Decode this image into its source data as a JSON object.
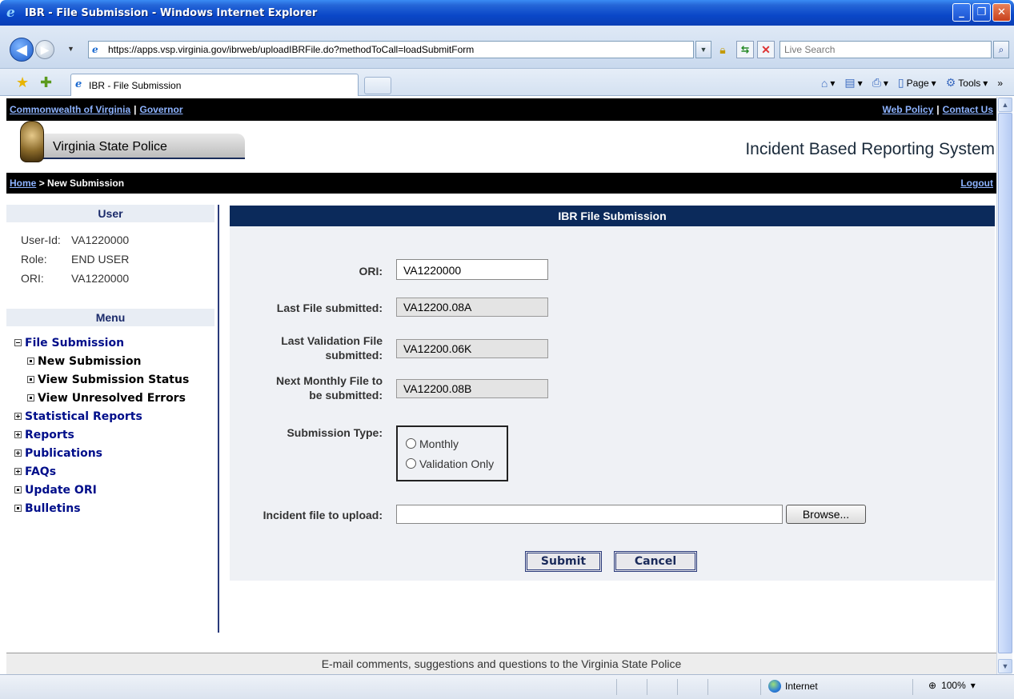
{
  "window": {
    "title": "IBR - File Submission - Windows Internet Explorer",
    "minimize": "_",
    "maximize": "❐",
    "close": "✕"
  },
  "browser": {
    "url": "https://apps.vsp.virginia.gov/ibrweb/uploadIBRFile.do?methodToCall=loadSubmitForm",
    "search_placeholder": "Live Search",
    "tab_title": "IBR - File Submission",
    "cmd_page": "Page",
    "cmd_tools": "Tools",
    "status_zone": "Internet",
    "zoom": "100%"
  },
  "top_links": {
    "commonwealth": "Commonwealth of Virginia",
    "governor": "Governor",
    "web_policy": "Web Policy",
    "contact_us": "Contact Us",
    "separator": "|"
  },
  "header": {
    "agency": "Virginia State Police",
    "app_title": "Incident Based Reporting System"
  },
  "breadcrumb": {
    "home": "Home",
    "current": "> New Submission",
    "logout": "Logout"
  },
  "sidebar": {
    "user_head": "User",
    "user_id_label": "User-Id:",
    "user_id": "VA1220000",
    "role_label": "Role:",
    "role": "END USER",
    "ori_label": "ORI:",
    "ori": "VA1220000",
    "menu_head": "Menu",
    "menu": {
      "file_submission": "File Submission",
      "new_submission": "New Submission",
      "view_status": "View Submission Status",
      "view_errors": "View Unresolved Errors",
      "statistical_reports": "Statistical Reports",
      "reports": "Reports",
      "publications": "Publications",
      "faqs": "FAQs",
      "update_ori": "Update ORI",
      "bulletins": "Bulletins"
    }
  },
  "form": {
    "title": "IBR File Submission",
    "ori_label": "ORI:",
    "ori_value": "VA1220000",
    "last_file_label": "Last File submitted:",
    "last_file_value": "VA12200.08A",
    "last_validation_label_1": "Last Validation File",
    "last_validation_label_2": "submitted:",
    "last_validation_value": "VA12200.06K",
    "next_monthly_label_1": "Next Monthly File to",
    "next_monthly_label_2": "be submitted:",
    "next_monthly_value": "VA12200.08B",
    "submission_type_label": "Submission Type:",
    "option_monthly": "Monthly",
    "option_validation": "Validation Only",
    "upload_label": "Incident file to upload:",
    "browse_label": "Browse...",
    "submit_label": "Submit",
    "cancel_label": "Cancel"
  },
  "footer": {
    "text": "E-mail comments, suggestions and questions to the Virginia State Police"
  }
}
